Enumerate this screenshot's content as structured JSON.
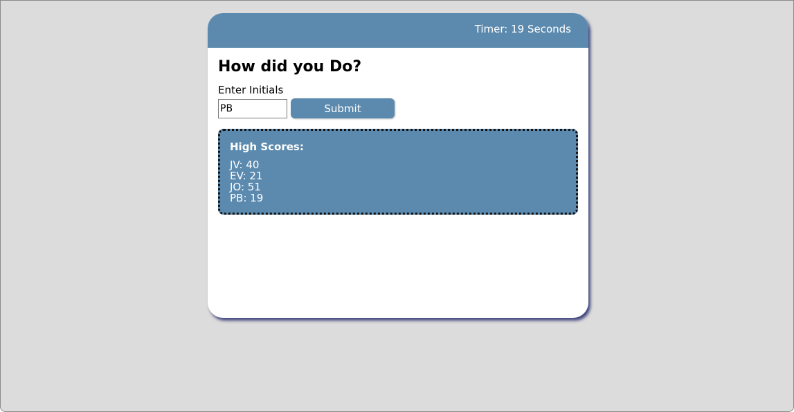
{
  "header": {
    "timer_text": "Timer: 19 Seconds"
  },
  "main": {
    "title": "How did you Do?",
    "initials_label": "Enter Initials",
    "initials_value": "PB",
    "submit_label": "Submit"
  },
  "high_scores": {
    "title": "High Scores:",
    "entries": [
      "JV: 40",
      "EV: 21",
      "JO: 51",
      "PB: 19"
    ]
  },
  "colors": {
    "accent": "#5c8aae",
    "background": "#dcdcdc",
    "card": "#ffffff"
  }
}
